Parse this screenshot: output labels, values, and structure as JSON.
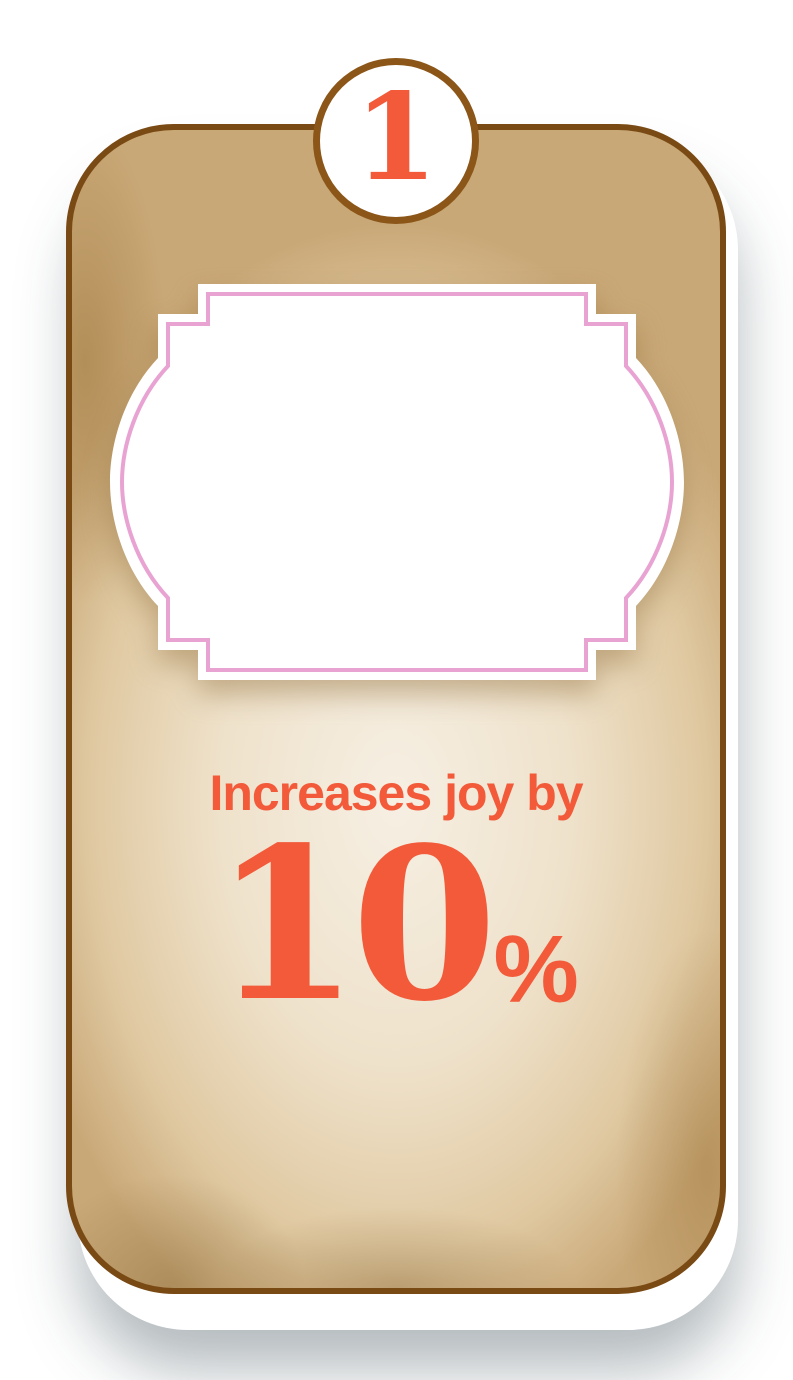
{
  "badge": {
    "number": "1"
  },
  "card": {
    "caption": "Increases joy by",
    "value": "10",
    "unit": "%"
  },
  "colors": {
    "accent": "#f25a3a",
    "card_border": "#7a4a14",
    "frame_border": "#e8a3d3",
    "parchment": "#efe2cb"
  },
  "icons": {
    "frame": "ornate-label-frame-icon"
  }
}
